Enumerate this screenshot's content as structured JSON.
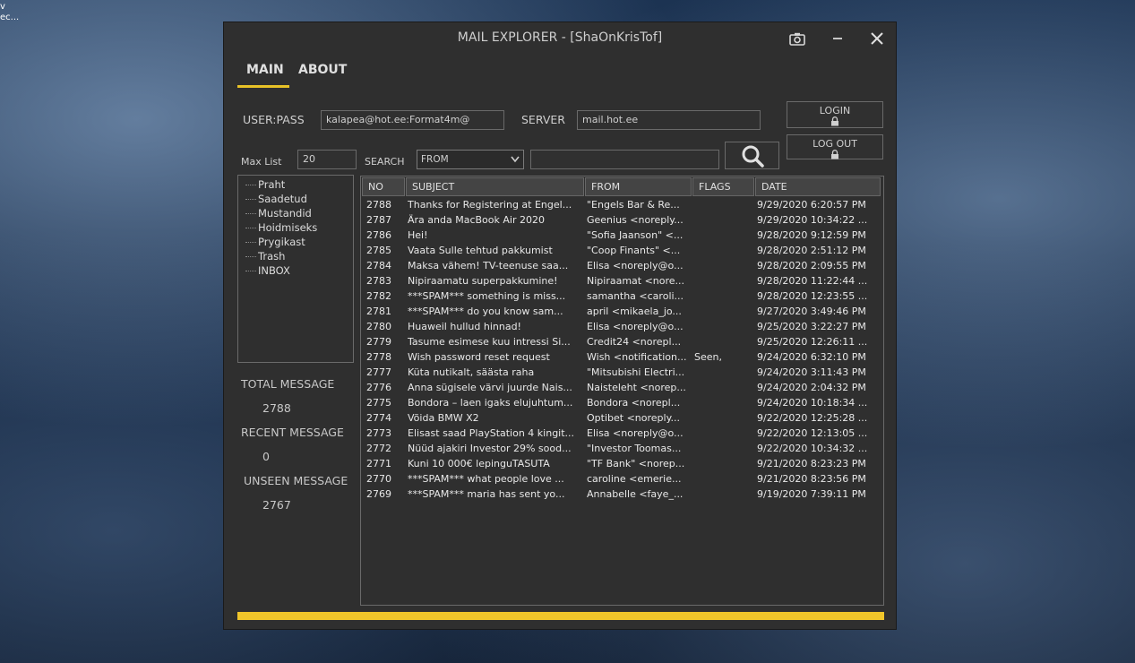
{
  "desktop": {
    "icon_label_1": "v",
    "icon_label_2": "ec..."
  },
  "window": {
    "title": "MAIL EXPLORER  - [ShaOnKrisTof]"
  },
  "tabs": {
    "main": "MAIN",
    "about": "ABOUT"
  },
  "login": {
    "user_pass_label": "USER:PASS",
    "user_pass_value": "kalapea@hot.ee:Format4m@",
    "server_label": "SERVER",
    "server_value": "mail.hot.ee",
    "login_label": "LOGIN",
    "logout_label": "LOG OUT"
  },
  "search": {
    "max_list_label": "Max List",
    "max_list_value": "20",
    "search_label": "SEARCH",
    "field_selected": "FROM",
    "query": ""
  },
  "folders": [
    "Praht",
    "Saadetud",
    "Mustandid",
    "Hoidmiseks",
    "Prygikast",
    "Trash",
    "INBOX"
  ],
  "stats": {
    "total_label": "TOTAL MESSAGE",
    "total_value": "2788",
    "recent_label": "RECENT MESSAGE",
    "recent_value": "0",
    "unseen_label": "UNSEEN MESSAGE",
    "unseen_value": "2767"
  },
  "grid": {
    "columns": [
      "NO",
      "SUBJECT",
      "FROM",
      "FLAGS",
      "DATE"
    ],
    "rows": [
      [
        "2788",
        "Thanks for Registering at Engel...",
        "\"Engels Bar & Re...",
        "",
        "9/29/2020 6:20:57 PM"
      ],
      [
        "2787",
        "Ära anda MacBook Air 2020",
        "Geenius <noreply...",
        "",
        "9/29/2020 10:34:22 ..."
      ],
      [
        "2786",
        "Hei!",
        "\"Sofia Jaanson\" <...",
        "",
        "9/28/2020 9:12:59 PM"
      ],
      [
        "2785",
        "Vaata Sulle tehtud pakkumist",
        "\"Coop Finants\" <...",
        "",
        "9/28/2020 2:51:12 PM"
      ],
      [
        "2784",
        "Maksa vähem! TV-teenuse saa...",
        "Elisa <noreply@o...",
        "",
        "9/28/2020 2:09:55 PM"
      ],
      [
        "2783",
        "Nipiraamatu superpakkumine!",
        "Nipiraamat <nore...",
        "",
        "9/28/2020 11:22:44 ..."
      ],
      [
        "2782",
        "***SPAM*** something is miss...",
        "samantha <caroli...",
        "",
        "9/28/2020 12:23:55 ..."
      ],
      [
        "2781",
        "***SPAM*** do you know sam...",
        "april <mikaela_jo...",
        "",
        "9/27/2020 3:49:46 PM"
      ],
      [
        "2780",
        "Huaweil hullud hinnad!",
        "Elisa <noreply@o...",
        "",
        "9/25/2020 3:22:27 PM"
      ],
      [
        "2779",
        "Tasume esimese kuu intressi Si...",
        "Credit24 <norepl...",
        "",
        "9/25/2020 12:26:11 ..."
      ],
      [
        "2778",
        "Wish password reset request",
        "Wish <notification...",
        "Seen,",
        "9/24/2020 6:32:10 PM"
      ],
      [
        "2777",
        "Küta nutikalt, säästa raha",
        "\"Mitsubishi Electri...",
        "",
        "9/24/2020 3:11:43 PM"
      ],
      [
        "2776",
        "Anna sügisele värvi juurde Nais...",
        "Naisteleht <norep...",
        "",
        "9/24/2020 2:04:32 PM"
      ],
      [
        "2775",
        "Bondora – laen igaks elujuhtum...",
        "Bondora <norepl...",
        "",
        "9/24/2020 10:18:34 ..."
      ],
      [
        "2774",
        "Võida BMW X2",
        "Optibet <noreply...",
        "",
        "9/22/2020 12:25:28 ..."
      ],
      [
        "2773",
        "Elisast saad PlayStation 4 kingit...",
        "Elisa <noreply@o...",
        "",
        "9/22/2020 12:13:05 ..."
      ],
      [
        "2772",
        "Nüüd ajakiri Investor 29% sood...",
        "\"Investor Toomas...",
        "",
        "9/22/2020 10:34:32 ..."
      ],
      [
        "2771",
        "Kuni 10 000€ lepinguTASUTA",
        "\"TF Bank\" <norep...",
        "",
        "9/21/2020 8:23:23 PM"
      ],
      [
        "2770",
        "***SPAM*** what people love ...",
        "caroline <emerie...",
        "",
        "9/21/2020 8:23:56 PM"
      ],
      [
        "2769",
        "***SPAM*** maria has sent yo...",
        "Annabelle <faye_...",
        "",
        "9/19/2020 7:39:11 PM"
      ]
    ]
  },
  "colors": {
    "accent": "#f0c52a",
    "panel_bg": "#2f2f2f",
    "border": "#6a6a6a"
  },
  "icons": {
    "camera": "camera-icon",
    "minimize": "minimize-icon",
    "close": "close-icon",
    "lock": "lock-icon",
    "search": "search-icon"
  }
}
